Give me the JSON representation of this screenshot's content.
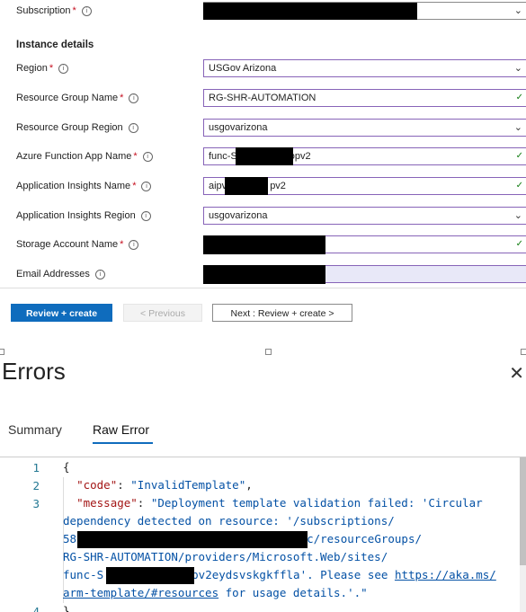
{
  "form": {
    "subscription": {
      "label": "Subscription",
      "required": "*"
    },
    "section_title": "Instance details",
    "region": {
      "label": "Region",
      "required": "*",
      "value": "USGov Arizona"
    },
    "resource_group_name": {
      "label": "Resource Group Name",
      "required": "*",
      "value": "RG-SHR-AUTOMATION"
    },
    "resource_group_region": {
      "label": "Resource Group Region",
      "value": "usgovarizona"
    },
    "function_app_name": {
      "label": "Azure Function App Name",
      "required": "*",
      "value_prefix": "func-S",
      "value_suffix": "opv2"
    },
    "app_insights_name": {
      "label": "Application Insights Name",
      "required": "*",
      "value_prefix": "aipv",
      "value_suffix": "pv2"
    },
    "app_insights_region": {
      "label": "Application Insights Region",
      "value": "usgovarizona"
    },
    "storage_account_name": {
      "label": "Storage Account Name",
      "required": "*"
    },
    "email_addresses": {
      "label": "Email Addresses"
    },
    "info_icon": "i",
    "chevron_icon": "chevron-down-icon",
    "check_icon": "checkmark-icon"
  },
  "buttons": {
    "review_create": "Review + create",
    "previous": "< Previous",
    "next": "Next : Review + create >"
  },
  "dialog": {
    "title": "Errors",
    "close_glyph": "✕",
    "tabs": [
      "Summary",
      "Raw Error"
    ],
    "active_tab": "Raw Error"
  },
  "code": {
    "line_numbers": [
      "1",
      "2",
      "3",
      "4"
    ],
    "l1": "{",
    "l2_key": "\"code\"",
    "l2_sep": ": ",
    "l2_val": "\"InvalidTemplate\"",
    "l2_end": ",",
    "l3_key": "\"message\"",
    "l3_sep": ": ",
    "l3_val_a": "\"Deployment template validation failed: 'Circular",
    "l3_val_b": "dependency detected on resource: '/subscriptions/",
    "l3_val_c_prefix": "58",
    "l3_val_c_suffix": "c/resourceGroups/",
    "l3_val_d": "RG-SHR-AUTOMATION/providers/Microsoft.Web/sites/",
    "l3_val_e_prefix": "func-S",
    "l3_val_e_suffix": "pv2eydsvskgkffla'. Please see ",
    "l3_link_a": "https://aka.ms/",
    "l3_link_b": "arm-template/#resources",
    "l3_val_f": " for usage details.'.\"",
    "l4": "}"
  },
  "colors": {
    "primary": "#0f6cbd",
    "field_border": "#8764b8",
    "check": "#107c10",
    "required": "#c50f1f"
  }
}
